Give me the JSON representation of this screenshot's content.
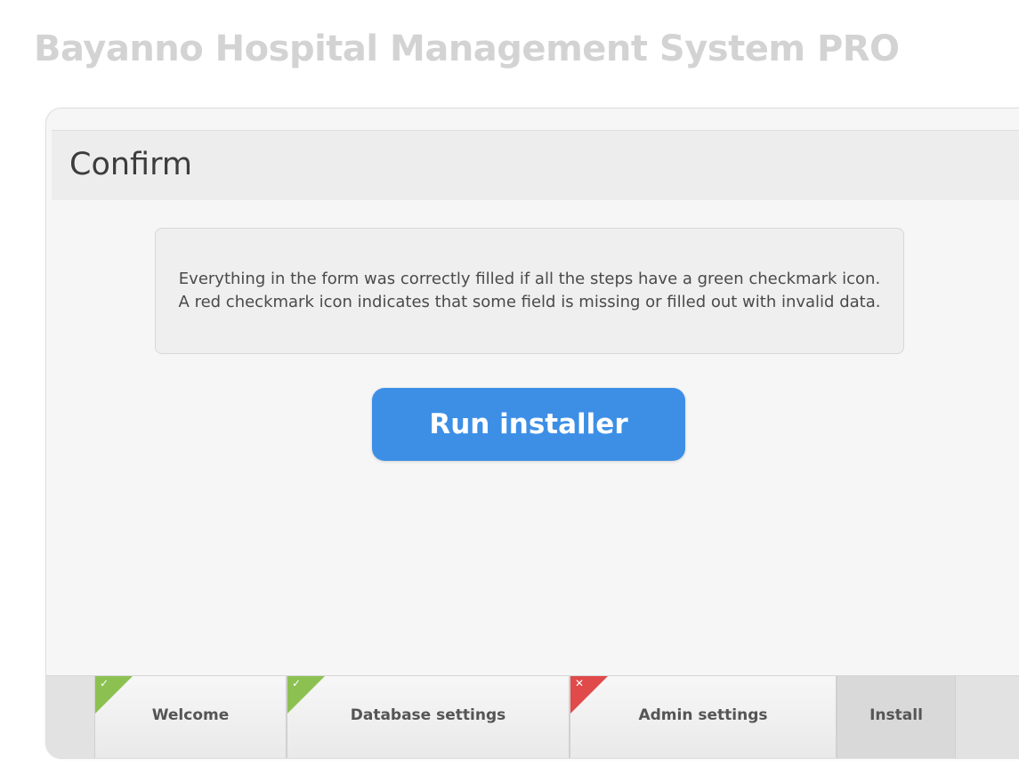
{
  "header": {
    "app_title": "Bayanno Hospital Management System PRO"
  },
  "panel": {
    "title": "Confirm",
    "info_text": "Everything in the form was correctly filled if all the steps have a green checkmark icon. A red checkmark icon indicates that some field is missing or filled out with invalid data.",
    "run_button_label": "Run installer"
  },
  "steps": [
    {
      "label": "Welcome",
      "status": "valid",
      "icon": "check-icon",
      "glyph": "✓"
    },
    {
      "label": "Database settings",
      "status": "valid",
      "icon": "check-icon",
      "glyph": "✓"
    },
    {
      "label": "Admin settings",
      "status": "invalid",
      "icon": "cross-icon",
      "glyph": "✕"
    },
    {
      "label": "Install",
      "status": "current",
      "icon": "",
      "glyph": ""
    }
  ],
  "colors": {
    "primary_button": "#3d8fe6",
    "valid": "#8cc152",
    "invalid": "#e04a4a"
  }
}
